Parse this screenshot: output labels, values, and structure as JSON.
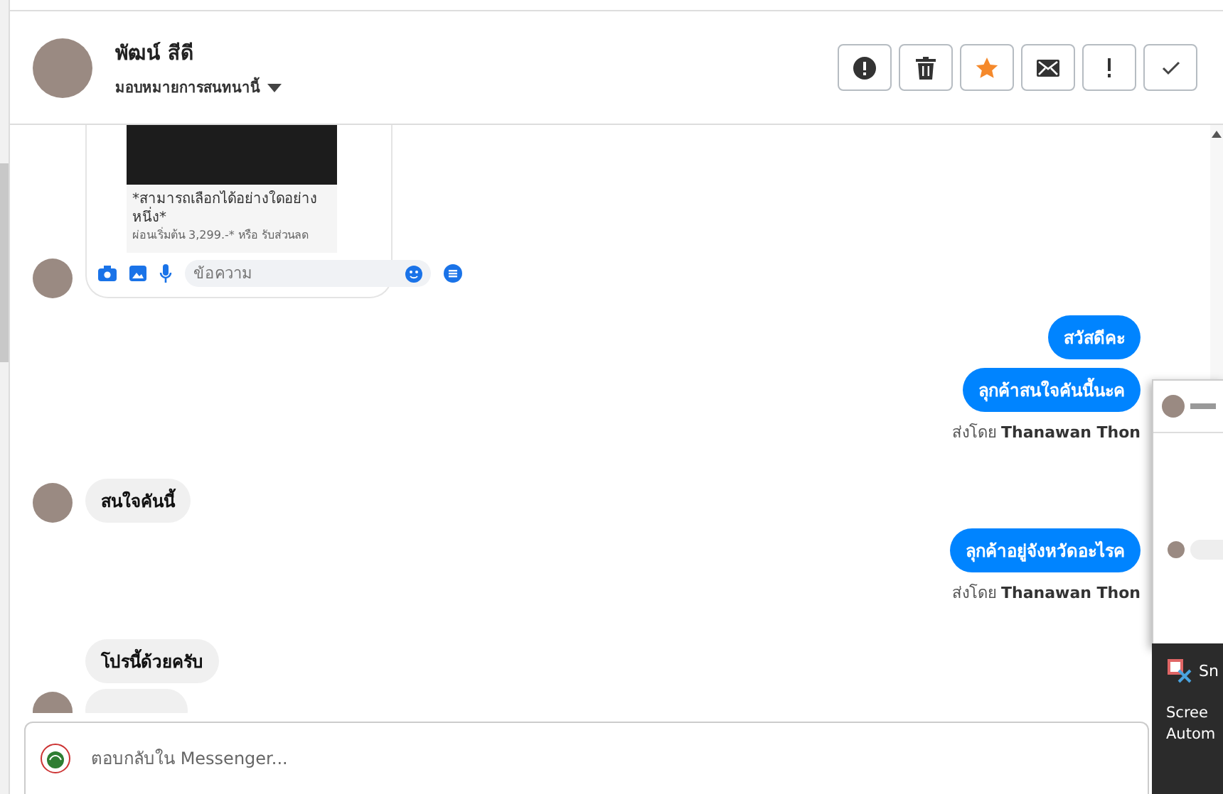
{
  "header": {
    "name": "พัฒน์ สีดี",
    "assign_label": "มอบหมายการสนทนานี้"
  },
  "actions": [
    {
      "kind": "alert"
    },
    {
      "kind": "trash"
    },
    {
      "kind": "star",
      "on": true
    },
    {
      "kind": "mail"
    },
    {
      "kind": "exclaim"
    },
    {
      "kind": "check"
    }
  ],
  "shared_post": {
    "title": "*สามารถเลือกได้อย่างใดอย่างหนึ่ง*",
    "description": "ผ่อนเริ่มต้น 3,299.-* หรือ รับส่วนลด",
    "placeholder": "ข้อความ"
  },
  "messages": [
    {
      "kind": "outgoing",
      "text": "สวัสดีคะ"
    },
    {
      "kind": "outgoing",
      "text": "ลุกค้าสนใจคันนี้นะค",
      "sent_by_label": "ส่งโดย",
      "sent_by_name": "Thanawan Thon"
    },
    {
      "kind": "incoming",
      "text": "สนใจคันนี้"
    },
    {
      "kind": "outgoing",
      "text": "ลุกค้าอยู่จังหวัดอะไรค",
      "sent_by_label": "ส่งโดย",
      "sent_by_name": "Thanawan Thon"
    },
    {
      "kind": "incoming",
      "text": "โปรนี้ด้วยครับ"
    },
    {
      "kind": "partial"
    }
  ],
  "composer": {
    "placeholder": "ตอบกลับใน Messenger..."
  },
  "notification": {
    "app": "Sn",
    "lines": [
      "Scree",
      "Autom"
    ]
  }
}
